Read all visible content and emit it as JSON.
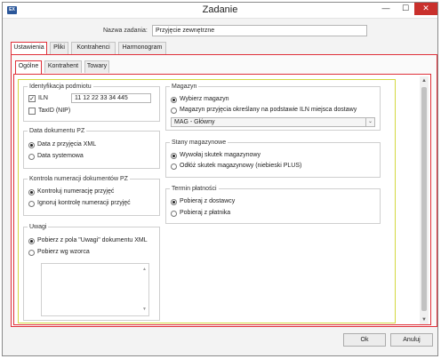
{
  "window": {
    "title": "Zadanie",
    "icon_label": "EX",
    "minimize_glyph": "—",
    "maximize_glyph": "☐",
    "close_glyph": "✕"
  },
  "task_name": {
    "label": "Nazwa zadania:",
    "value": "Przyjęcie zewnętrzne"
  },
  "outer_tabs": [
    "Ustawienia",
    "Pliki",
    "Kontrahenci",
    "Harmonogram"
  ],
  "inner_tabs": [
    "Ogólne",
    "Kontrahent",
    "Towary"
  ],
  "subject_id": {
    "title": "Identyfikacja podmiotu",
    "iln_label": "ILN",
    "iln_checked": true,
    "iln_value": "11 12 22 33 34 445",
    "taxid_label": "TaxID (NIP)",
    "taxid_checked": false
  },
  "pz_date": {
    "title": "Data dokumentu PZ",
    "options": [
      "Data z przyjęcia XML",
      "Data systemowa"
    ],
    "selected": 0
  },
  "numbering": {
    "title": "Kontrola numeracji dokumentów PZ",
    "options": [
      "Kontroluj numerację przyjęć",
      "Ignoruj kontrolę numeracji przyjęć"
    ],
    "selected": 0
  },
  "notes": {
    "title": "Uwagi",
    "options": [
      "Pobierz z pola \"Uwagi\" dokumentu XML",
      "Pobierz wg wzorca"
    ],
    "selected": 0,
    "textarea_value": ""
  },
  "warehouse": {
    "title": "Magazyn",
    "options": [
      "Wybierz magazyn",
      "Magazyn przyjęcia określany na podstawie ILN miejsca dostawy"
    ],
    "selected": 0,
    "select_value": "MAG - Główny"
  },
  "stock": {
    "title": "Stany magazynowe",
    "options": [
      "Wywołaj skutek magazynowy",
      "Odłóż skutek magazynowy (niebieski PLUS)"
    ],
    "selected": 0
  },
  "payment": {
    "title": "Termin płatności",
    "options": [
      "Pobieraj z dostawcy",
      "Pobieraj z płatnika"
    ],
    "selected": 0
  },
  "buttons": {
    "ok": "Ok",
    "cancel": "Anuluj"
  },
  "glyphs": {
    "checkmark": "✓",
    "arrow_up": "▲",
    "arrow_down": "▼",
    "chevron_down": "⌄"
  },
  "colors": {
    "highlight_red": "#e0303a",
    "highlight_yellow": "#d4d840",
    "close_button": "#c9302c"
  }
}
